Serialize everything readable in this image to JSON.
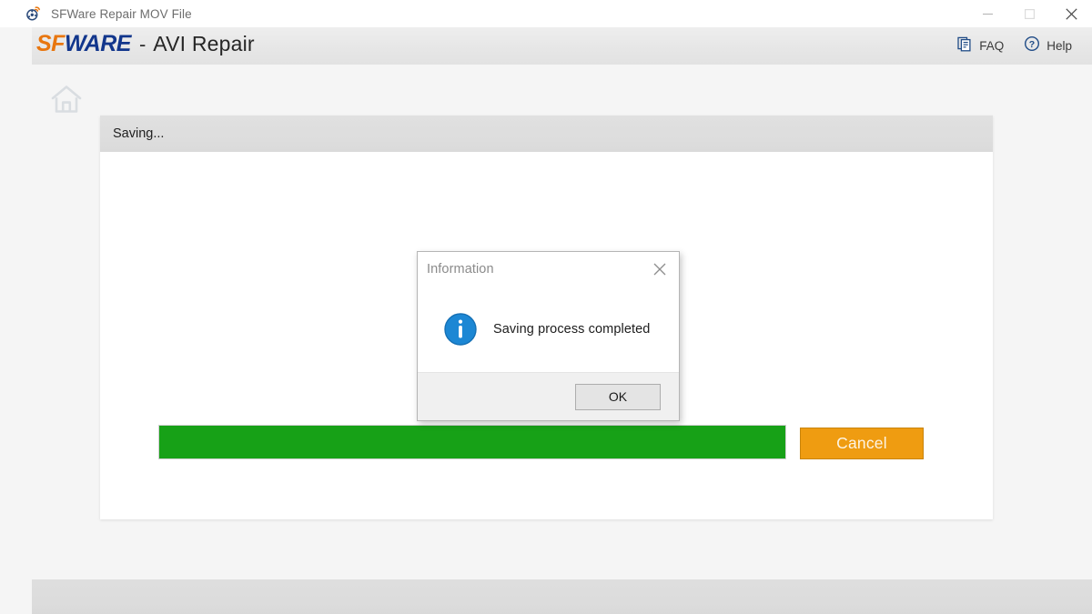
{
  "window": {
    "title": "SFWare Repair MOV File",
    "app_icon": "film-reel-icon",
    "controls": {
      "minimize": "minimize-icon",
      "maximize": "maximize-icon",
      "close": "close-icon"
    }
  },
  "header": {
    "brand_first": "SF",
    "brand_second": "WARE",
    "separator": "-",
    "module": "AVI Repair",
    "brand_color_first": "#e8760f",
    "brand_color_second": "#12368c",
    "actions": [
      {
        "label": "FAQ",
        "icon": "faq-document-icon"
      },
      {
        "label": "Help",
        "icon": "help-question-icon"
      }
    ]
  },
  "nav": {
    "home_icon": "home-icon"
  },
  "panel": {
    "title": "Saving...",
    "graphic": "film-reel-graphic"
  },
  "progress": {
    "percent": 100,
    "fill_color": "#17a117",
    "track_color": "#ffffff"
  },
  "buttons": {
    "cancel": "Cancel",
    "cancel_color": "#ef9c11"
  },
  "dialog": {
    "title": "Information",
    "message": "Saving process completed",
    "icon": "info-circle-icon",
    "icon_color": "#1c87d4",
    "ok_label": "OK",
    "close_icon": "close-icon"
  }
}
